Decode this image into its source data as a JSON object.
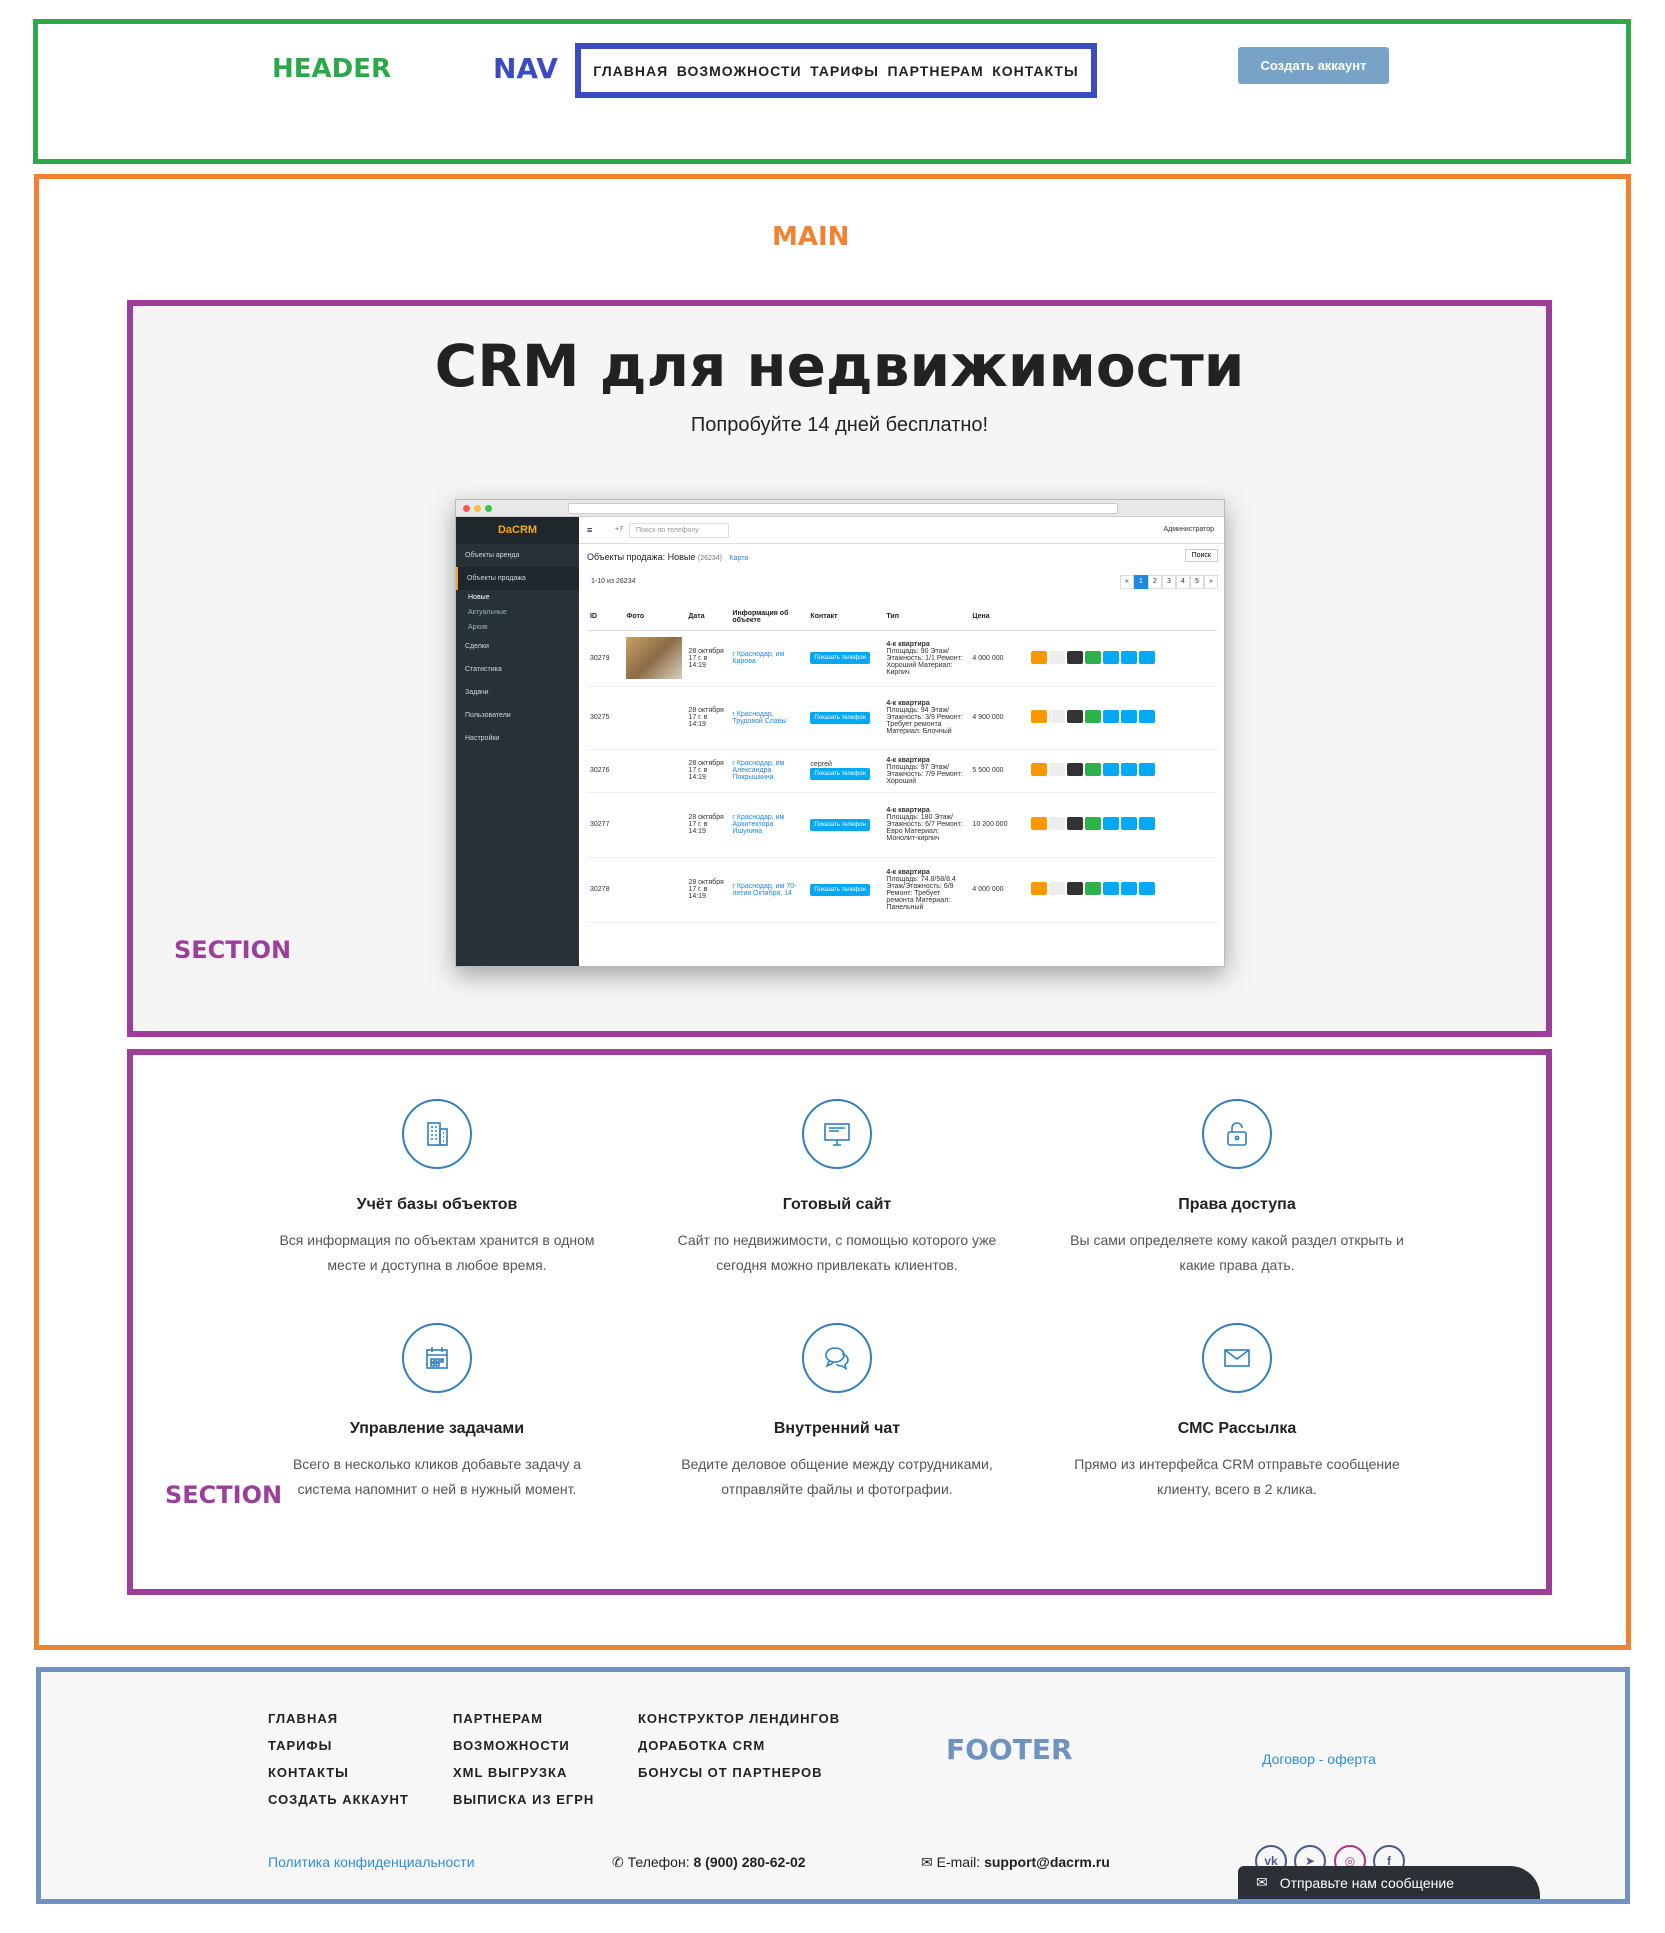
{
  "labels": {
    "header": "HEADER",
    "nav": "NAV",
    "main": "MAIN",
    "section": "SECTION",
    "footer": "FOOTER"
  },
  "nav": {
    "items": [
      "ГЛАВНАЯ",
      "ВОЗМОЖНОСТИ",
      "ТАРИФЫ",
      "ПАРТНЕРАМ",
      "КОНТАКТЫ"
    ],
    "cta": "Создать аккаунт"
  },
  "hero": {
    "title": "CRM для недвижимости",
    "subtitle": "Попробуйте 14 дней бесплатно!"
  },
  "app": {
    "brand": "DaCRM",
    "sidebar": [
      "Объекты аренда",
      "Объекты продажа",
      "Новые",
      "Актуальные",
      "Архив",
      "Сделки",
      "Статистика",
      "Задачи",
      "Пользователи",
      "Настройки"
    ],
    "phone_prefix": "+7",
    "search_placeholder": "Поиск по телефону",
    "admin": "Администратор",
    "crumb_title": "Объекты продажа: Новые",
    "crumb_count": "(26234)",
    "map_link": "Карта",
    "search_btn": "Поиск",
    "range": "1-10 из 26234",
    "pages": [
      "«",
      "1",
      "2",
      "3",
      "4",
      "5",
      "»"
    ],
    "columns": [
      "ID",
      "Фото",
      "Дата",
      "Информация об объекте",
      "Контакт",
      "Тип",
      "Цена"
    ],
    "phone_btn": "Показать телефон",
    "rows": [
      {
        "id": "30279",
        "date": "28 октября 17 г. в 14:19",
        "addr": "г Краснодар, им Кирова",
        "contact": "",
        "type": "4-к квартира",
        "details": "Площадь: 90 Этаж/Этажность: 1/1 Ремонт: Хороший Материал: Кирпич",
        "price": "4 000 000"
      },
      {
        "id": "30275",
        "date": "28 октября 17 г. в 14:19",
        "addr": "г Краснодар, Трудовой Славы",
        "contact": "",
        "type": "4-к квартира",
        "details": "Площадь: 94 Этаж/Этажность: 3/9 Ремонт: Требует ремонта Материал: Блочный",
        "price": "4 900 000"
      },
      {
        "id": "30276",
        "date": "28 октября 17 г. в 14:19",
        "addr": "г Краснодар, им Александра Покрышкина",
        "contact": "сергей",
        "type": "4-к квартира",
        "details": "Площадь: 97 Этаж/Этажность: 7/9 Ремонт: Хороший",
        "price": "5 500 000"
      },
      {
        "id": "30277",
        "date": "28 октября 17 г. в 14:19",
        "addr": "г Краснодар, им Архитектора Ишунина",
        "contact": "",
        "type": "4-к квартира",
        "details": "Площадь: 180 Этаж/Этажность: 6/7 Ремонт: Евро Материал: Монолит-кирпич",
        "price": "10 200 000"
      },
      {
        "id": "30278",
        "date": "28 октября 17 г. в 14:19",
        "addr": "г Краснодар, им 70-летия Октября, 14",
        "contact": "",
        "type": "4-к квартира",
        "details": "Площадь: 74.8/58/8.4 Этаж/Этажность: 6/9 Ремонт: Требует ремонта Материал: Панельный",
        "price": "4 000 000"
      }
    ]
  },
  "features": [
    {
      "icon": "building-icon",
      "title": "Учёт базы объектов",
      "text": "Вся информация по объектам хранится в одном месте и доступна в любое время."
    },
    {
      "icon": "monitor-icon",
      "title": "Готовый сайт",
      "text": "Сайт по недвижимости, с помощью которого уже сегодня можно привлекать клиентов."
    },
    {
      "icon": "lock-icon",
      "title": "Права доступа",
      "text": "Вы сами определяете кому какой раздел открыть и какие права дать."
    },
    {
      "icon": "calendar-icon",
      "title": "Управление задачами",
      "text": "Всего в несколько кликов добавьте задачу а система напомнит о ней в нужный момент."
    },
    {
      "icon": "chat-icon",
      "title": "Внутренний чат",
      "text": "Ведите деловое общение между сотрудниками, отправляйте файлы и фотографии."
    },
    {
      "icon": "envelope-icon",
      "title": "СМС Рассылка",
      "text": "Прямо из интерфейса CRM отправьте сообщение клиенту, всего в 2 клика."
    }
  ],
  "footer": {
    "col1": [
      "ГЛАВНАЯ",
      "ТАРИФЫ",
      "КОНТАКТЫ",
      "СОЗДАТЬ АККАУНТ"
    ],
    "col2": [
      "ПАРТНЕРАМ",
      "ВОЗМОЖНОСТИ",
      "XML ВЫГРУЗКА",
      "ВЫПИСКА ИЗ ЕГРН"
    ],
    "col3": [
      "КОНСТРУКТОР ЛЕНДИНГОВ",
      "ДОРАБОТКА CRM",
      "БОНУСЫ ОТ ПАРТНЕРОВ"
    ],
    "oferta": "Договор - оферта",
    "privacy": "Политика конфиденциальности",
    "phone_label": "Телефон:",
    "phone": "8 (900) 280-62-02",
    "email_label": "E-mail:",
    "email": "support@dacrm.ru",
    "socials": [
      "vk-icon",
      "telegram-icon",
      "instagram-icon",
      "facebook-icon"
    ],
    "chat_widget": "Отправьте нам сообщение"
  },
  "colors": {
    "header_outline": "#2aa84a",
    "nav_outline": "#3b4bc0",
    "main_outline": "#f08232",
    "section_outline": "#9b3f9b",
    "footer_outline": "#6f92c0",
    "accent_blue": "#2f7fc1"
  }
}
